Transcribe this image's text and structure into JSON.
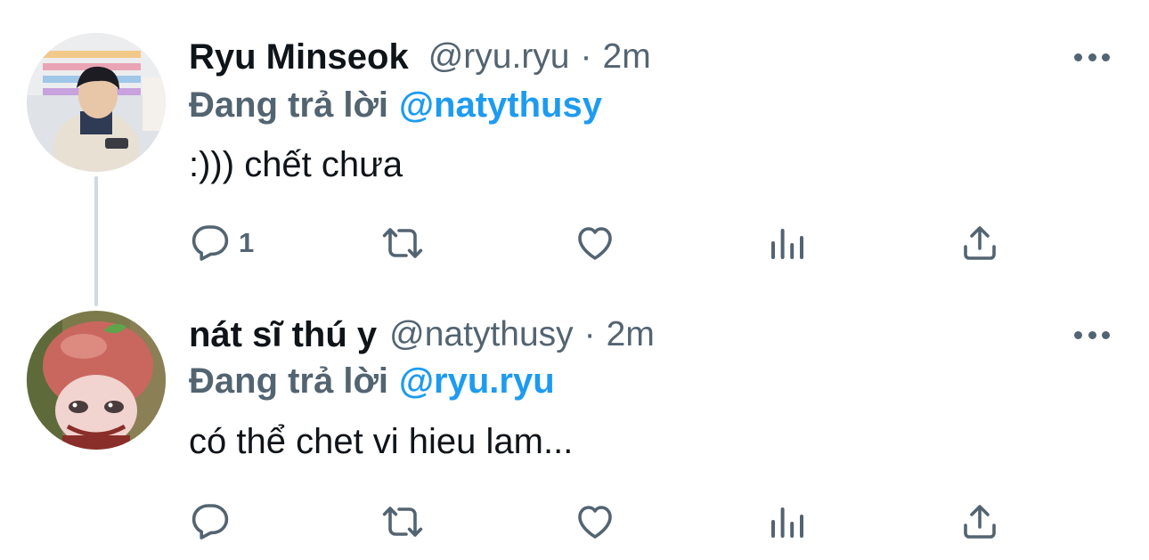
{
  "tweets": [
    {
      "name": "Ryu Minseok",
      "handle": "@ryu.ryu",
      "separator": "·",
      "time": "2m",
      "reply_prefix": "Đang trả lời",
      "reply_to": "@natythusy",
      "text": ":))) chết chưa",
      "reply_count": "1",
      "avatar_icon": "photo-avatar"
    },
    {
      "name": "nát sĩ thú y",
      "handle": "@natythusy",
      "separator": "·",
      "time": "2m",
      "reply_prefix": "Đang trả lời",
      "reply_to": "@ryu.ryu",
      "text": "có thể chet vi hieu lam...",
      "reply_count": "",
      "avatar_icon": "figurine-avatar"
    }
  ],
  "icons": {
    "reply": "reply-icon",
    "retweet": "retweet-icon",
    "like": "heart-icon",
    "views": "views-icon",
    "share": "share-icon",
    "more": "more-icon"
  },
  "colors": {
    "text": "#0f1419",
    "muted": "#536471",
    "mention": "#1d9bf0",
    "thread_line": "#cfd9de",
    "background": "#ffffff"
  }
}
